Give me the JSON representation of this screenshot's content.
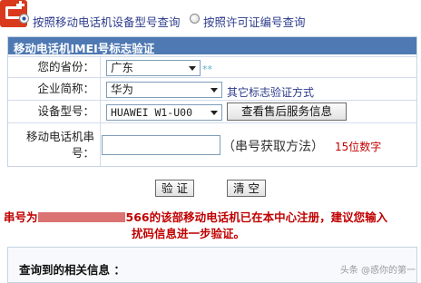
{
  "radio_options": [
    {
      "label": "按照移动电话机设备型号查询",
      "selected": true
    },
    {
      "label": "按照许可证编号查询",
      "selected": false
    }
  ],
  "form": {
    "title": "移动电话机IMEI号标志验证",
    "province": {
      "label": "您的省份：",
      "value": "广东",
      "mark": "**"
    },
    "company": {
      "label": "企业简称：",
      "value": "华为",
      "link": "其它标志验证方式"
    },
    "model": {
      "label": "设备型号：",
      "value": "HUAWEI W1-U00",
      "button": "查看售后服务信息"
    },
    "serial": {
      "label_line1": "移动电话机串",
      "label_line2": "号：",
      "value": "",
      "hint": "（串号获取方法）",
      "digits_note": "15位数字"
    }
  },
  "buttons": {
    "verify": "验 证",
    "clear": "清 空"
  },
  "result_message": {
    "line1_prefix": "串号为",
    "line1_visible_tail": "566的该部移动电话机已在本中心注册，建议您输入",
    "line2": "扰码信息进一步验证。"
  },
  "result_section": {
    "title": "查询到的相关信息 ："
  },
  "watermark": "头条 @惑你的第一"
}
